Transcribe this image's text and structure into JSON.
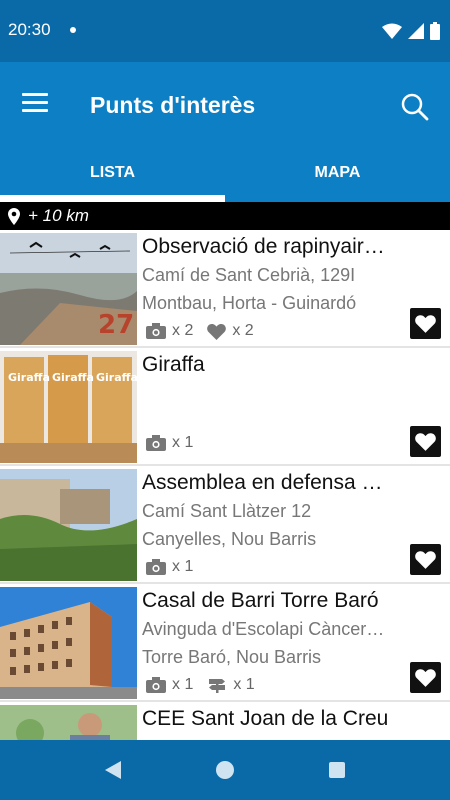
{
  "status_bar": {
    "time": "20:30"
  },
  "app_bar": {
    "title": "Punts d'interès"
  },
  "tabs": [
    {
      "label": "LISTA",
      "selected": true
    },
    {
      "label": "MAPA",
      "selected": false
    }
  ],
  "distance": {
    "label": "+ 10 km"
  },
  "items": [
    {
      "title": "Observació de rapinyair…",
      "address": "Camí de Sant Cebrià, 129I",
      "district": "Montbau, Horta - Guinardó",
      "photos": "x 2",
      "likes": "x 2",
      "directions": ""
    },
    {
      "title": "Giraffa",
      "address": "",
      "district": "",
      "photos": "x 1",
      "likes": "",
      "directions": ""
    },
    {
      "title": "Assemblea en defensa …",
      "address": "Camí Sant Llàtzer 12",
      "district": "Canyelles, Nou Barris",
      "photos": "x 1",
      "likes": "",
      "directions": ""
    },
    {
      "title": "Casal de Barri Torre Baró",
      "address": "Avinguda d'Escolapi Càncer…",
      "district": "Torre Baró, Nou Barris",
      "photos": "x 1",
      "likes": "",
      "directions": "x 1"
    },
    {
      "title": "CEE Sant Joan de la Creu",
      "address": "",
      "district": "",
      "photos": "",
      "likes": "",
      "directions": ""
    }
  ],
  "colors": {
    "status_bar": "#0a6aa8",
    "app_bar": "#0d7fc4",
    "distance_bar": "#000000"
  }
}
